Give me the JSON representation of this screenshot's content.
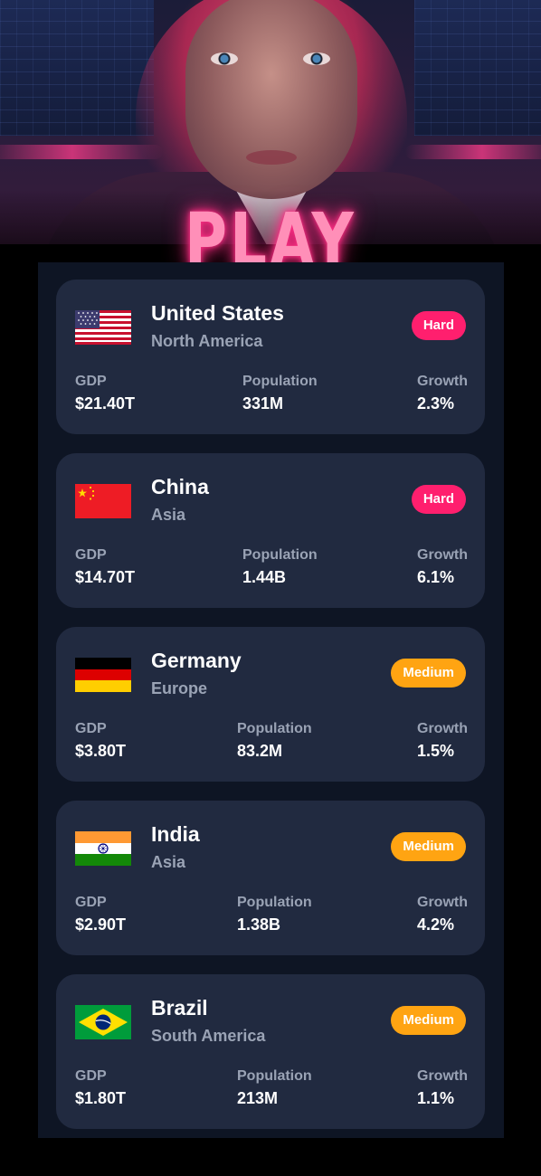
{
  "title": "PLAY",
  "colors": {
    "hard": "#ff1f6e",
    "medium": "#ffa412",
    "card": "#212a40",
    "panel": "#0e1524",
    "label": "#9aa3b5"
  },
  "stat_labels": {
    "gdp": "GDP",
    "population": "Population",
    "growth": "Growth"
  },
  "countries": [
    {
      "name": "United States",
      "region": "North America",
      "difficulty": "Hard",
      "gdp": "$21.40T",
      "population": "331M",
      "growth": "2.3%",
      "flag_icon": "us-flag-icon"
    },
    {
      "name": "China",
      "region": "Asia",
      "difficulty": "Hard",
      "gdp": "$14.70T",
      "population": "1.44B",
      "growth": "6.1%",
      "flag_icon": "china-flag-icon"
    },
    {
      "name": "Germany",
      "region": "Europe",
      "difficulty": "Medium",
      "gdp": "$3.80T",
      "population": "83.2M",
      "growth": "1.5%",
      "flag_icon": "germany-flag-icon"
    },
    {
      "name": "India",
      "region": "Asia",
      "difficulty": "Medium",
      "gdp": "$2.90T",
      "population": "1.38B",
      "growth": "4.2%",
      "flag_icon": "india-flag-icon"
    },
    {
      "name": "Brazil",
      "region": "South America",
      "difficulty": "Medium",
      "gdp": "$1.80T",
      "population": "213M",
      "growth": "1.1%",
      "flag_icon": "brazil-flag-icon"
    }
  ]
}
